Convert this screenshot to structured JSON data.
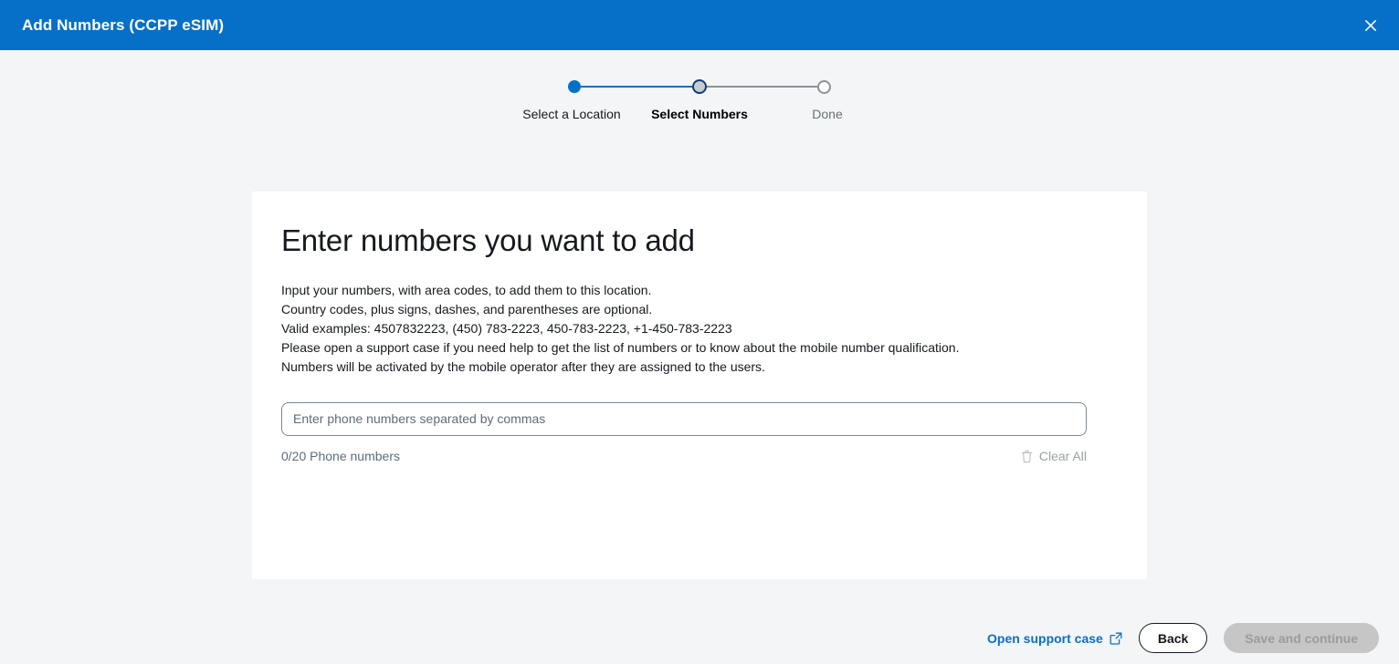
{
  "titlebar": {
    "title": "Add Numbers (CCPP eSIM)",
    "close_icon": "close-icon"
  },
  "stepper": {
    "steps": [
      {
        "label": "Select a Location",
        "state": "done"
      },
      {
        "label": "Select Numbers",
        "state": "current"
      },
      {
        "label": "Done",
        "state": "todo"
      }
    ],
    "accent_color": "#0670c8",
    "inactive_color": "#8d9197"
  },
  "card": {
    "title": "Enter numbers you want to add",
    "description_lines": [
      "Input your numbers, with area codes, to add them to this location.",
      "Country codes, plus signs, dashes, and parentheses are optional.",
      "Valid examples: 4507832223, (450) 783-2223, 450-783-2223, +1-450-783-2223",
      "Please open a support case if you need help to get the list of numbers or to know about the mobile number qualification.",
      "Numbers will be activated by the mobile operator after they are assigned to the users."
    ],
    "input": {
      "value": "",
      "placeholder": "Enter phone numbers separated by commas"
    },
    "counter": "0/20 Phone numbers",
    "clear_all": {
      "label": "Clear All",
      "icon": "trash-icon"
    }
  },
  "footer": {
    "support_link": {
      "label": "Open support case",
      "icon": "external-link-icon"
    },
    "back_label": "Back",
    "save_label": "Save and continue"
  }
}
